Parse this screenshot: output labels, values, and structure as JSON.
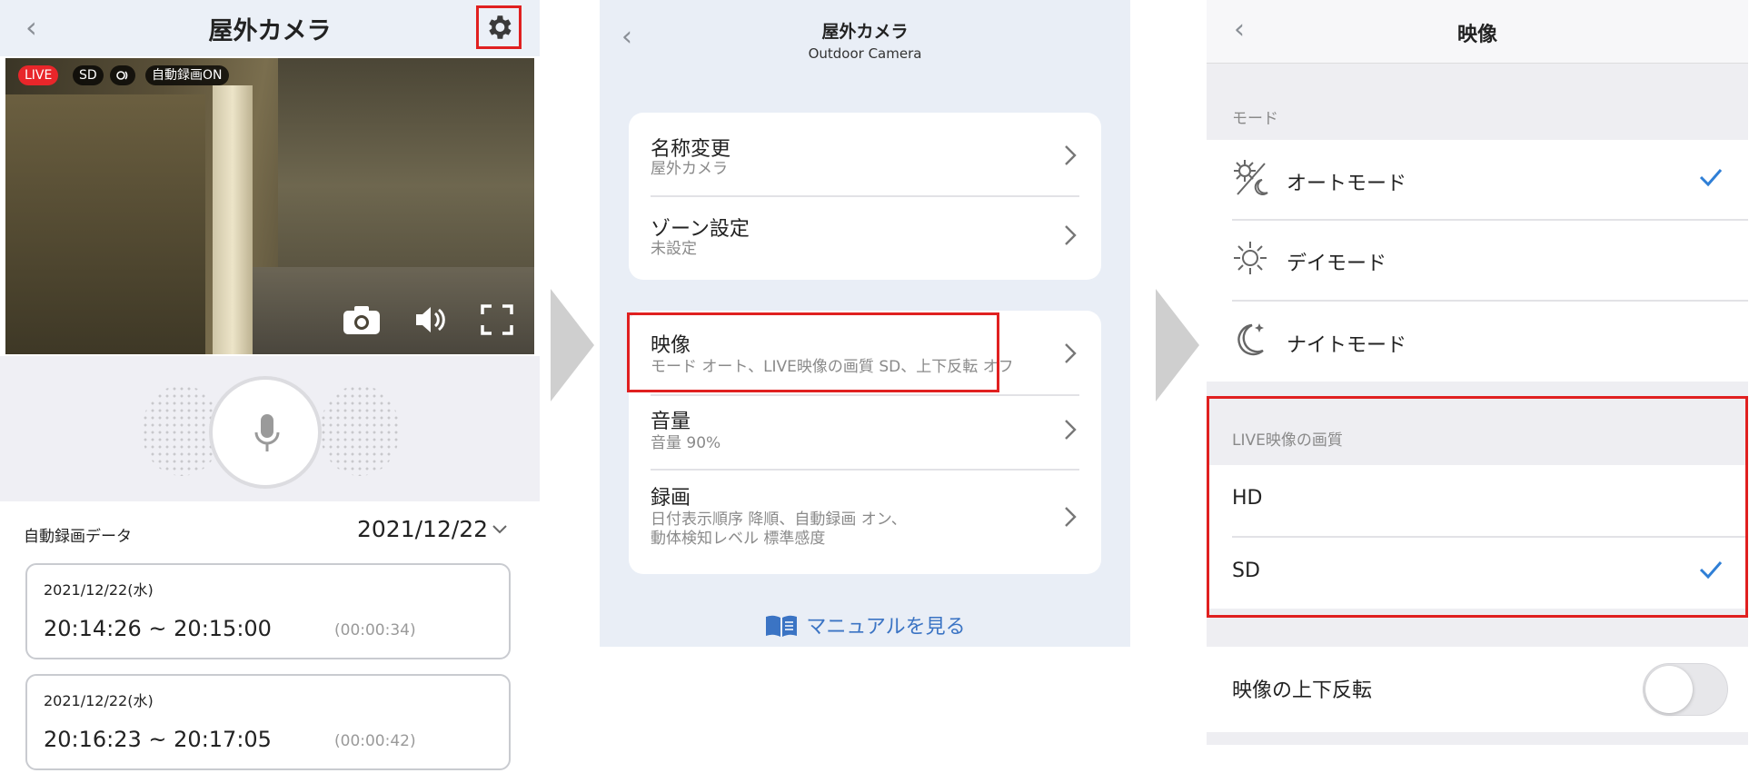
{
  "panel1": {
    "title": "屋外カメラ",
    "badges": {
      "live": "LIVE",
      "sd": "SD",
      "auto_record": "自動録画ON"
    },
    "recording_label": "自動録画データ",
    "selected_date": "2021/12/22",
    "recordings": [
      {
        "date": "2021/12/22(水)",
        "time_range": "20:14:26 ~ 20:15:00",
        "duration": "(00:00:34)"
      },
      {
        "date": "2021/12/22(水)",
        "time_range": "20:16:23 ~ 20:17:05",
        "duration": "(00:00:42)"
      }
    ]
  },
  "panel2": {
    "title": "屋外カメラ",
    "subtitle": "Outdoor Camera",
    "items": [
      {
        "label": "名称変更",
        "value": "屋外カメラ"
      },
      {
        "label": "ゾーン設定",
        "value": "未設定"
      },
      {
        "label": "映像",
        "value": "モード オート、LIVE映像の画質 SD、上下反転 オフ"
      },
      {
        "label": "音量",
        "value": "音量 90%"
      },
      {
        "label": "録画",
        "value_line1": "日付表示順序 降順、自動録画 オン、",
        "value_line2": "動体検知レベル 標準感度"
      }
    ],
    "manual_link": "マニュアルを見る"
  },
  "panel3": {
    "title": "映像",
    "mode_section": "モード",
    "modes": [
      {
        "label": "オートモード",
        "selected": true
      },
      {
        "label": "デイモード",
        "selected": false
      },
      {
        "label": "ナイトモード",
        "selected": false
      }
    ],
    "quality_section": "LIVE映像の画質",
    "qualities": [
      {
        "label": "HD",
        "selected": false
      },
      {
        "label": "SD",
        "selected": true
      }
    ],
    "flip_label": "映像の上下反転",
    "flip_on": false
  },
  "colors": {
    "highlight": "#e02020",
    "live": "#e8262a",
    "check": "#2f7fd6",
    "link": "#3b74c4"
  },
  "icons": [
    "chevron-left-icon",
    "gear-icon",
    "camera-icon",
    "speaker-icon",
    "fullscreen-icon",
    "microphone-icon",
    "chevron-down-icon",
    "chevron-right-icon",
    "book-icon",
    "auto-mode-icon",
    "day-mode-icon",
    "night-mode-icon",
    "checkmark-icon"
  ]
}
